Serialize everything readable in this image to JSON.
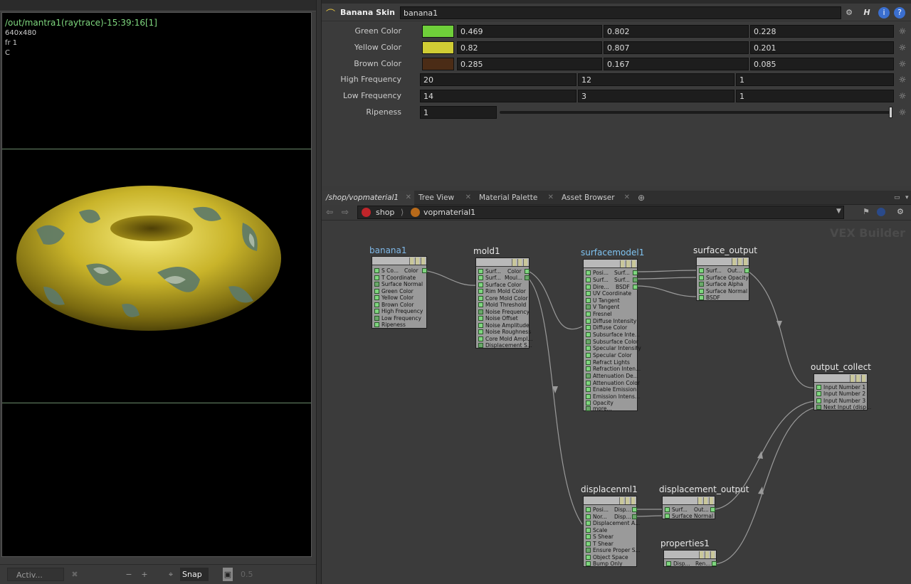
{
  "render_view": {
    "title": "/out/mantra1(raytrace)-15:39:16[1]",
    "resolution": "640x480",
    "frame": "fr 1",
    "channel": "C",
    "bottom_bar": {
      "mode": "Activ...",
      "snap_label": "Snap",
      "value": "0.5"
    }
  },
  "params": {
    "node_type": "Banana Skin",
    "node_name": "banana1",
    "rows": [
      {
        "label": "Green Color",
        "swatch": "#6fcf3a",
        "values": [
          "0.469",
          "0.802",
          "0.228"
        ]
      },
      {
        "label": "Yellow Color",
        "swatch": "#d0cd34",
        "values": [
          "0.82",
          "0.807",
          "0.201"
        ]
      },
      {
        "label": "Brown Color",
        "swatch": "#4b2c16",
        "values": [
          "0.285",
          "0.167",
          "0.085"
        ]
      },
      {
        "label": "High Frequency",
        "values": [
          "20",
          "12",
          "1"
        ]
      },
      {
        "label": "Low Frequency",
        "values": [
          "14",
          "3",
          "1"
        ]
      },
      {
        "label": "Ripeness",
        "values": [
          "1"
        ],
        "slider_fraction": 1.0
      }
    ]
  },
  "network": {
    "tabs": [
      {
        "label": "/shop/vopmaterial1"
      },
      {
        "label": "Tree View"
      },
      {
        "label": "Material Palette"
      },
      {
        "label": "Asset Browser"
      }
    ],
    "breadcrumbs": [
      "shop",
      "vopmaterial1"
    ],
    "context_label": "VEX Builder",
    "nodes": {
      "banana1": {
        "name": "banana1",
        "ports": [
          "S Co...",
          "T Coordinate",
          "Surface Normal",
          "Green Color",
          "Yellow Color",
          "Brown Color",
          "High Frequency",
          "Low Frequency",
          "Ripeness"
        ],
        "outputs": [
          "Color"
        ]
      },
      "mold1": {
        "name": "mold1",
        "ports": [
          "Surf...",
          "Surf...",
          "Surface Color",
          "Rim Mold Color",
          "Core Mold Color",
          "Mold Threshold",
          "Noise Frequency",
          "Noise Offset",
          "Noise Amplitude",
          "Noise Roughness",
          "Core Mold Ampl...",
          "Displacement S..."
        ],
        "outputs": [
          "Color",
          "Moul..."
        ]
      },
      "surfacemodel1": {
        "name": "surfacemodel1",
        "ports": [
          "Posi...",
          "Surf...",
          "Dire...",
          "UV Coordinate",
          "U Tangent",
          "V Tangent",
          "Fresnel",
          "Diffuse Intensity",
          "Diffuse Color",
          "Subsurface Inte...",
          "Subsurface Color",
          "Specular Intensity",
          "Specular Color",
          "Refract Lights",
          "Refraction Inten...",
          "Attenuation De...",
          "Attenuation Color",
          "Enable Emission",
          "Emission Intens...",
          "Opacity",
          "more..."
        ],
        "outputs": [
          "Surf...",
          "Surf...",
          "BSDF"
        ]
      },
      "surface_output": {
        "name": "surface_output",
        "ports": [
          "Surf...",
          "Surface Opacity",
          "Surface Alpha",
          "Surface Normal",
          "BSDF"
        ],
        "outputs": [
          "Out..."
        ]
      },
      "output_collect": {
        "name": "output_collect",
        "ports": [
          "Input Number 1",
          "Input Number 2",
          "Input Number 3",
          "Next Input (disp..."
        ]
      },
      "displacenml1": {
        "name": "displacenml1",
        "ports": [
          "Posi...",
          "Nor...",
          "Displacement A...",
          "Scale",
          "S Shear",
          "T Shear",
          "Ensure Proper S...",
          "Object Space",
          "Bump Only"
        ],
        "outputs": [
          "Disp...",
          "Disp..."
        ]
      },
      "displacement_output": {
        "name": "displacement_output",
        "ports": [
          "Surf...",
          "Surface Normal"
        ],
        "outputs": [
          "Out..."
        ]
      },
      "properties1": {
        "name": "properties1",
        "ports": [
          "Disp..."
        ],
        "outputs": [
          "Ren..."
        ]
      }
    }
  }
}
